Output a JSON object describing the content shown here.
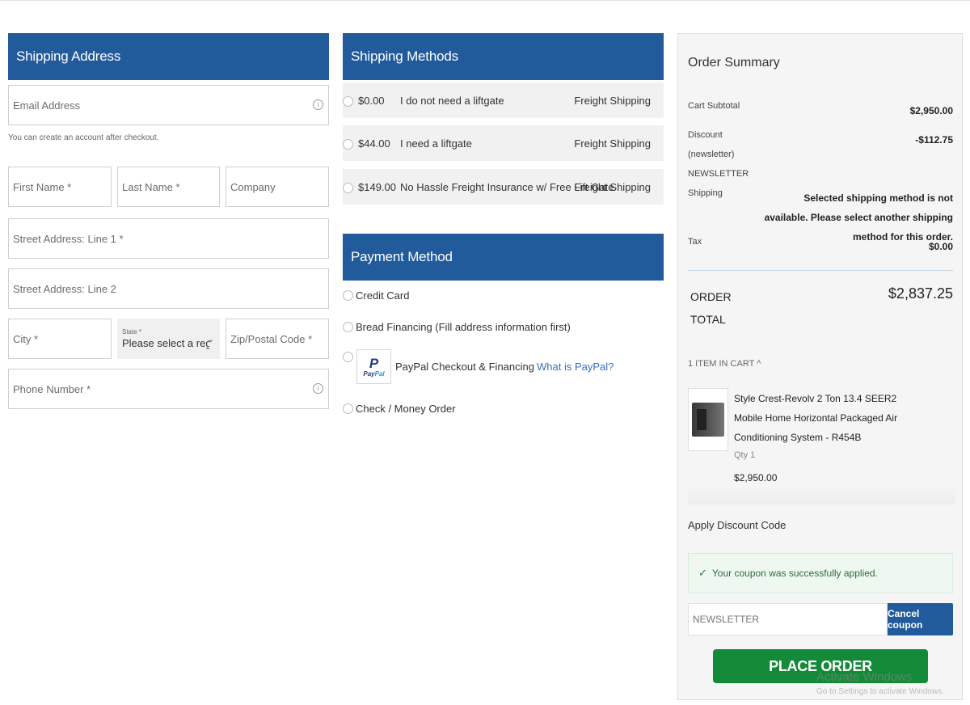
{
  "shipping_address": {
    "title": "Shipping Address",
    "email_placeholder": "Email Address",
    "email_hint": "You can create an account after checkout.",
    "first_name": "First Name *",
    "last_name": "Last Name *",
    "company": "Company",
    "street1": "Street Address: Line 1 *",
    "street2": "Street Address: Line 2",
    "city": "City *",
    "state_label": "State *",
    "state_value": "Please select a region, state or province.",
    "zip": "Zip/Postal Code *",
    "phone": "Phone Number *",
    "info_icon": "i"
  },
  "shipping_methods": {
    "title": "Shipping Methods",
    "options": [
      {
        "price": "$0.00",
        "label": "I do not need a liftgate",
        "carrier": "Freight Shipping"
      },
      {
        "price": "$44.00",
        "label": "I need a liftgate",
        "carrier": "Freight Shipping"
      },
      {
        "price": "$149.00",
        "label": "No Hassle Freight Insurance w/ Free Lift Gate",
        "carrier": "Freight Shipping"
      }
    ]
  },
  "payment": {
    "title": "Payment Method",
    "credit_card": "Credit Card",
    "bread": "Bread Financing (Fill address information first)",
    "paypal_label": "PayPal Checkout & Financing",
    "paypal_link": "What is PayPal?",
    "paypal_logo_a": "Pay",
    "paypal_logo_b": "Pal",
    "check": "Check / Money Order"
  },
  "order_summary": {
    "title": "Order Summary",
    "subtotal_label": "Cart Subtotal",
    "subtotal_value": "$2,950.00",
    "discount_label_1": "Discount",
    "discount_label_2": "(newsletter)",
    "discount_label_3": "NEWSLETTER",
    "discount_value": "-$112.75",
    "shipping_label": "Shipping",
    "shipping_note": "Selected shipping method is not available. Please select another shipping method for this order.",
    "tax_label": "Tax",
    "tax_value": "$0.00",
    "total_label_1": "ORDER",
    "total_label_2": "TOTAL",
    "total_value": "$2,837.25",
    "cart_count": "1 ITEM IN CART ^",
    "item": {
      "name": "Style Crest-Revolv 2 Ton 13.4 SEER2 Mobile Home Horizontal Packaged Air Conditioning System - R454B",
      "qty": "Qty 1",
      "price": "$2,950.00"
    },
    "discount_title": "Apply Discount Code",
    "success_msg": "Your coupon was successfully applied.",
    "check_icon": "✓",
    "coupon_value": "NEWSLETTER",
    "cancel_label": "Cancel coupon",
    "place_order": "PLACE ORDER"
  },
  "watermark": {
    "line1": "Activate Windows",
    "line2": "Go to Settings to activate Windows."
  },
  "colors": {
    "header_blue": "#215b9c",
    "place_order_green": "#128a38",
    "link_blue": "#3a6fc2"
  }
}
